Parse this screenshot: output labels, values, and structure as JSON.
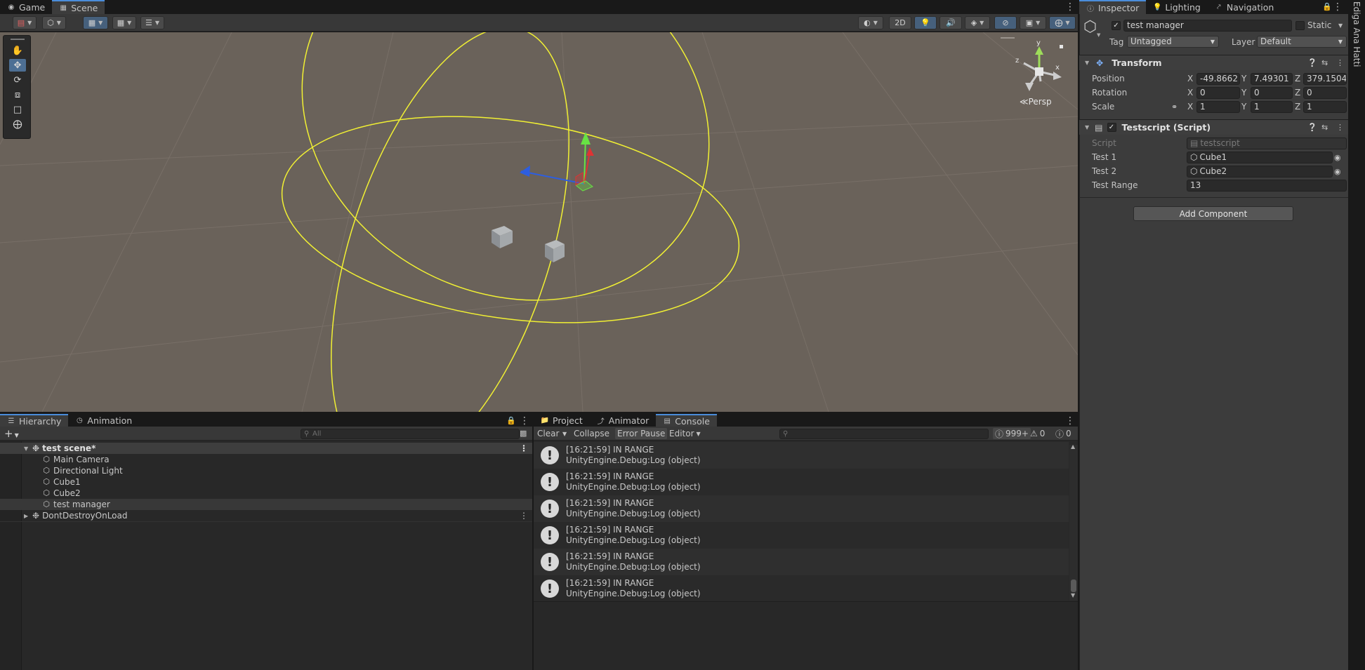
{
  "colors": {
    "scene_bg": "#6a625a",
    "gizmo_yellow": "#f1f033",
    "accent_blue": "#4a8ddb"
  },
  "top_tabs": {
    "game": "Game",
    "scene": "Scene"
  },
  "scene_toolbar": {
    "btn_2d": "2D"
  },
  "scene": {
    "persp_label": "Persp",
    "gizmo_axes": {
      "x": "x",
      "y": "y",
      "z": "z"
    }
  },
  "hierarchy": {
    "tabs": [
      "Hierarchy",
      "Animation"
    ],
    "add_label": "+",
    "search_placeholder": "All",
    "rows": [
      {
        "label": "test scene*",
        "type": "scene"
      },
      {
        "label": "Main Camera",
        "type": "object"
      },
      {
        "label": "Directional Light",
        "type": "object"
      },
      {
        "label": "Cube1",
        "type": "object"
      },
      {
        "label": "Cube2",
        "type": "object"
      },
      {
        "label": "test manager",
        "type": "object",
        "selected": true
      },
      {
        "label": "DontDestroyOnLoad",
        "type": "scene"
      }
    ]
  },
  "console": {
    "tabs": [
      "Project",
      "Animator",
      "Console"
    ],
    "clear": "Clear",
    "collapse": "Collapse",
    "error_pause": "Error Pause",
    "editor": "Editor",
    "count_log": "999+",
    "count_warn": "0",
    "count_error": "0",
    "logs": [
      {
        "line1": "[16:21:59] IN RANGE",
        "line2": "UnityEngine.Debug:Log (object)"
      },
      {
        "line1": "[16:21:59] IN RANGE",
        "line2": "UnityEngine.Debug:Log (object)"
      },
      {
        "line1": "[16:21:59] IN RANGE",
        "line2": "UnityEngine.Debug:Log (object)"
      },
      {
        "line1": "[16:21:59] IN RANGE",
        "line2": "UnityEngine.Debug:Log (object)"
      },
      {
        "line1": "[16:21:59] IN RANGE",
        "line2": "UnityEngine.Debug:Log (object)"
      },
      {
        "line1": "[16:21:59] IN RANGE",
        "line2": "UnityEngine.Debug:Log (object)"
      }
    ]
  },
  "inspector": {
    "tabs": [
      "Inspector",
      "Lighting",
      "Navigation"
    ],
    "side_text": "Ediga Ana Hatti",
    "object_name": "test manager",
    "static_label": "Static",
    "tag_label": "Tag",
    "tag_value": "Untagged",
    "layer_label": "Layer",
    "layer_value": "Default",
    "transform": {
      "title": "Transform",
      "position_label": "Position",
      "rotation_label": "Rotation",
      "scale_label": "Scale",
      "position": {
        "x": "-49.8662",
        "y": "7.49301",
        "z": "379.1504"
      },
      "rotation": {
        "x": "0",
        "y": "0",
        "z": "0"
      },
      "scale": {
        "x": "1",
        "y": "1",
        "z": "1"
      }
    },
    "script": {
      "title": "Testscript (Script)",
      "script_label": "Script",
      "script_value": "testscript",
      "test1_label": "Test 1",
      "test1_value": "Cube1",
      "test2_label": "Test 2",
      "test2_value": "Cube2",
      "range_label": "Test Range",
      "range_value": "13"
    },
    "add_component": "Add Component"
  }
}
